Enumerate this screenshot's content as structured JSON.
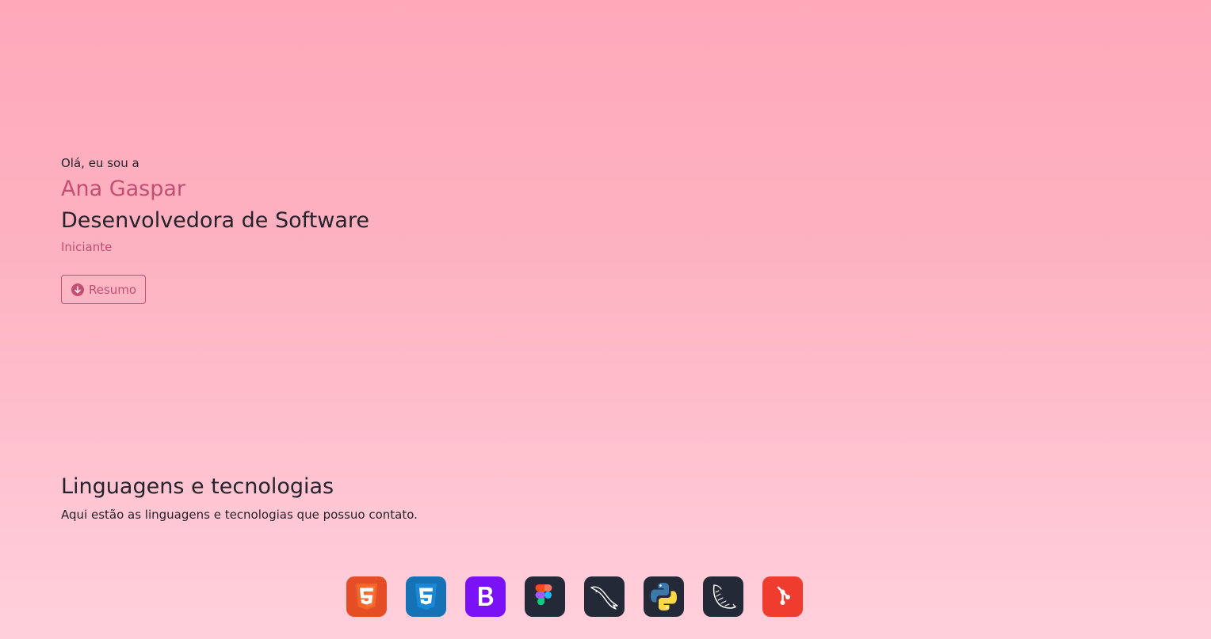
{
  "hero": {
    "greeting": "Olá, eu sou a",
    "name": "Ana Gaspar",
    "role": "Desenvolvedora de Software",
    "level": "Iniciante",
    "resume_label": "Resumo"
  },
  "skills": {
    "title": "Linguagens e tecnologias",
    "subtitle": "Aqui estão as linguagens e tecnologias que possuo contato."
  },
  "technologies": [
    {
      "icon": "html5-icon",
      "color": "#e44d26"
    },
    {
      "icon": "css3-icon",
      "color": "#1572b6"
    },
    {
      "icon": "bootstrap-icon",
      "color": "#7a12f5"
    },
    {
      "icon": "figma-icon",
      "color": "#242938"
    },
    {
      "icon": "mysql-icon",
      "color": "#242938"
    },
    {
      "icon": "python-icon",
      "color": "#242938"
    },
    {
      "icon": "flask-icon",
      "color": "#242938"
    },
    {
      "icon": "git-icon",
      "color": "#f03c2e"
    }
  ],
  "colors": {
    "accent": "#c24f72",
    "text": "#26222b"
  }
}
